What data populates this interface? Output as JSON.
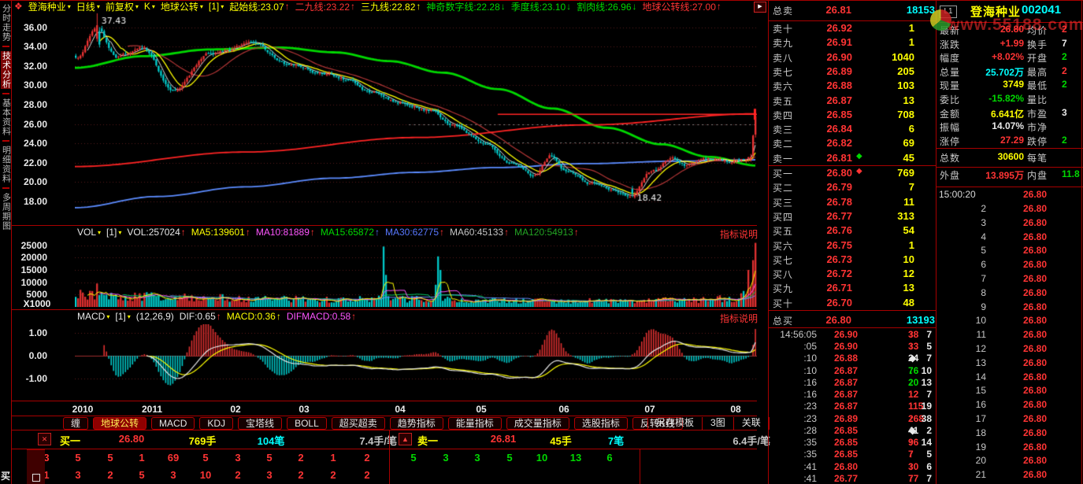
{
  "colors": {
    "up_red": "#ee3434",
    "down_cyan": "#00cdcd",
    "accent_yellow": "#ffff00",
    "accent_cyan": "#00ffff",
    "accent_green": "#00d800",
    "border_red": "#a80000",
    "label_gray": "#c8c8c8"
  },
  "icons": {
    "app": "❖",
    "dropdown": "▾",
    "play": "▶",
    "close": "✕",
    "up": "▲",
    "diamond": "◆",
    "arrow_up": "↑",
    "arrow_down": "↓"
  },
  "sidebar": {
    "items": [
      {
        "label": "分时走势",
        "active": false
      },
      {
        "label": "技术分析",
        "active": true
      },
      {
        "label": "基本资料",
        "active": false
      },
      {
        "label": "明细资料",
        "active": false
      },
      {
        "label": "多周期图",
        "active": false
      }
    ]
  },
  "chart_header": {
    "items": [
      {
        "t": "登海种业",
        "dd": true,
        "c": "yellow"
      },
      {
        "t": "日线",
        "dd": true,
        "c": "yellow"
      },
      {
        "t": "前复权",
        "dd": true,
        "c": "yellow"
      },
      {
        "t": "K",
        "dd": true,
        "c": "yellow"
      },
      {
        "t": "地球公转",
        "dd": true,
        "c": "yellow"
      },
      {
        "t": "[1]",
        "dd": true,
        "c": "yellow"
      },
      {
        "t": "起始线:23.07",
        "a": "↑",
        "c": "yellow",
        "ac": "red"
      },
      {
        "t": "二九线:23.22",
        "a": "↑",
        "c": "red",
        "ac": "red"
      },
      {
        "t": "三九线:22.82",
        "a": "↑",
        "c": "yellow",
        "ac": "yellow"
      },
      {
        "t": "神奇数字线:22.28",
        "a": "↓",
        "c": "green",
        "ac": "green"
      },
      {
        "t": "季度线:23.10",
        "a": "↓",
        "c": "green",
        "ac": "green"
      },
      {
        "t": "割肉线:26.96",
        "a": "↓",
        "c": "green",
        "ac": "green"
      },
      {
        "t": "地球公转线:27.00",
        "a": "↑",
        "c": "red",
        "ac": "red"
      }
    ]
  },
  "main_chart": {
    "y_ticks": [
      "36.00",
      "34.00",
      "32.00",
      "30.00",
      "28.00",
      "26.00",
      "24.00",
      "22.00",
      "20.00",
      "18.00"
    ]
  },
  "volume_pane": {
    "legend_note": "指标说明",
    "unit": "X1000",
    "ticks": [
      "25000",
      "20000",
      "15000",
      "10000",
      "5000"
    ],
    "items": [
      {
        "t": "VOL",
        "dd": true,
        "c": "white"
      },
      {
        "t": "[1]",
        "dd": true,
        "c": "white"
      },
      {
        "t": "VOL:257024",
        "a": "↑",
        "c": "white",
        "ac": "red"
      },
      {
        "t": "MA5:139601",
        "a": "↑",
        "c": "yellow",
        "ac": "red"
      },
      {
        "t": "MA10:81889",
        "a": "↑",
        "c": "magenta",
        "ac": "red"
      },
      {
        "t": "MA15:65872",
        "a": "↑",
        "c": "green",
        "ac": "blue"
      },
      {
        "t": "MA30:62775",
        "a": "↑",
        "c": "blue",
        "ac": "red"
      },
      {
        "t": "MA60:45133",
        "a": "↑",
        "c": "gray",
        "ac": "red"
      },
      {
        "t": "MA120:54913",
        "a": "↑",
        "c": "green2",
        "ac": "red"
      }
    ]
  },
  "macd_pane": {
    "legend_note": "指标说明",
    "ticks": [
      "1.00",
      "0.00",
      "-1.00"
    ],
    "items": [
      {
        "t": "MACD",
        "dd": true,
        "c": "white"
      },
      {
        "t": "[1]",
        "dd": true,
        "c": "white"
      },
      {
        "t": "(12,26,9)",
        "c": "white"
      },
      {
        "t": "DIF:0.65",
        "a": "↑",
        "c": "white",
        "ac": "red"
      },
      {
        "t": "MACD:0.36",
        "a": "↑",
        "c": "yellow",
        "ac": "yellow"
      },
      {
        "t": "DIFMACD:0.58",
        "a": "↑",
        "c": "magenta",
        "ac": "red"
      }
    ]
  },
  "x_axis": [
    "2010",
    "2011",
    "02",
    "03",
    "04",
    "05",
    "06",
    "07",
    "08"
  ],
  "tabs": {
    "left": [
      "缠",
      "地球公转",
      "MACD",
      "KDJ",
      "宝塔线",
      "BOLL",
      "超买超卖",
      "趋势指标",
      "能量指标",
      "成交量指标",
      "选股指标",
      "反转K线"
    ],
    "active_index": 1,
    "right": [
      "另存模板",
      "3图",
      "关联"
    ]
  },
  "bottom": {
    "buy": {
      "label": "买一",
      "price": "26.80",
      "lots": "769手",
      "counts": "104笔",
      "avg": "7.4手/笔"
    },
    "sell": {
      "label": "卖一",
      "price": "26.81",
      "lots": "45手",
      "counts": "7笔",
      "avg": "6.4手/笔"
    },
    "grid": {
      "row1_red": [
        "3",
        "5",
        "5",
        "1",
        "69",
        "5",
        "3",
        "5",
        "2",
        "1",
        "2"
      ],
      "row1_green": [
        "5",
        "3",
        "3",
        "5",
        "10",
        "13",
        "6"
      ],
      "row2_red": [
        "1",
        "3",
        "2",
        "5",
        "3",
        "10",
        "2",
        "3",
        "2",
        "2",
        "2"
      ],
      "row2_green": []
    },
    "corner": "买"
  },
  "right_panel": {
    "watermark": "www.55188.com",
    "total_sell": {
      "label": "总卖",
      "price": "26.81",
      "volume": "18153"
    },
    "total_buy": {
      "label": "总买",
      "price": "26.80",
      "volume": "13193"
    },
    "sell_levels": [
      {
        "label": "卖十",
        "price": "26.92",
        "vol": "1"
      },
      {
        "label": "卖九",
        "price": "26.91",
        "vol": "1"
      },
      {
        "label": "卖八",
        "price": "26.90",
        "vol": "1040"
      },
      {
        "label": "卖七",
        "price": "26.89",
        "vol": "205"
      },
      {
        "label": "卖六",
        "price": "26.88",
        "vol": "103"
      },
      {
        "label": "卖五",
        "price": "26.87",
        "vol": "13"
      },
      {
        "label": "卖四",
        "price": "26.85",
        "vol": "708"
      },
      {
        "label": "卖三",
        "price": "26.84",
        "vol": "6"
      },
      {
        "label": "卖二",
        "price": "26.82",
        "vol": "69"
      },
      {
        "label": "卖一",
        "price": "26.81",
        "vol": "45",
        "diamond": "green"
      }
    ],
    "buy_levels": [
      {
        "label": "买一",
        "price": "26.80",
        "vol": "769",
        "diamond": "red"
      },
      {
        "label": "买二",
        "price": "26.79",
        "vol": "7"
      },
      {
        "label": "买三",
        "price": "26.78",
        "vol": "11"
      },
      {
        "label": "买四",
        "price": "26.77",
        "vol": "313"
      },
      {
        "label": "买五",
        "price": "26.76",
        "vol": "54"
      },
      {
        "label": "买六",
        "price": "26.75",
        "vol": "1"
      },
      {
        "label": "买七",
        "price": "26.73",
        "vol": "10"
      },
      {
        "label": "买八",
        "price": "26.72",
        "vol": "12"
      },
      {
        "label": "买九",
        "price": "26.71",
        "vol": "13"
      },
      {
        "label": "买十",
        "price": "26.70",
        "vol": "48"
      }
    ],
    "ticks": [
      {
        "time": "14:56:05",
        "price": "26.90",
        "vol": "38",
        "dir": "up",
        "n": "7"
      },
      {
        "time": ":05",
        "price": "26.90",
        "vol": "33",
        "dir": "up",
        "n": "5"
      },
      {
        "time": ":10",
        "price": "26.88",
        "vol": "24",
        "dir": "flat",
        "n": "7"
      },
      {
        "time": ":10",
        "price": "26.87",
        "vol": "76",
        "dir": "down",
        "n": "10"
      },
      {
        "time": ":16",
        "price": "26.87",
        "vol": "20",
        "dir": "down",
        "n": "13"
      },
      {
        "time": ":16",
        "price": "26.87",
        "vol": "12",
        "dir": "up",
        "n": "7"
      },
      {
        "time": ":23",
        "price": "26.87",
        "vol": "115",
        "dir": "up",
        "n": "19"
      },
      {
        "time": ":23",
        "price": "26.89",
        "vol": "268",
        "dir": "up",
        "n": "38"
      },
      {
        "time": ":28",
        "price": "26.85",
        "vol": "41",
        "dir": "flat",
        "n": "2"
      },
      {
        "time": ":35",
        "price": "26.85",
        "vol": "96",
        "dir": "up",
        "n": "14"
      },
      {
        "time": ":35",
        "price": "26.85",
        "vol": "7",
        "dir": "up",
        "n": "5"
      },
      {
        "time": ":41",
        "price": "26.80",
        "vol": "30",
        "dir": "up",
        "n": "6"
      },
      {
        "time": ":41",
        "price": "26.77",
        "vol": "77",
        "dir": "up",
        "n": "7"
      }
    ],
    "info": {
      "badge": "L1",
      "name": "登海种业",
      "code": "002041",
      "stats": [
        {
          "l": "最新",
          "lv": "26.80",
          "lc": "red",
          "r": "均价",
          "rv": "2",
          "rc": "red"
        },
        {
          "l": "涨跌",
          "lv": "+1.99",
          "lc": "red",
          "r": "换手",
          "rv": "7",
          "rc": "white"
        },
        {
          "l": "幅度",
          "lv": "+8.02%",
          "lc": "red",
          "r": "开盘",
          "rv": "2",
          "rc": "green"
        },
        {
          "l": "总量",
          "lv": "25.702万",
          "lc": "cyan",
          "r": "最高",
          "rv": "2",
          "rc": "red"
        },
        {
          "l": "现量",
          "lv": "3749",
          "lc": "yellow",
          "r": "最低",
          "rv": "2",
          "rc": "green"
        },
        {
          "l": "委比",
          "lv": "-15.82%",
          "lc": "green",
          "r": "量比",
          "rv": "",
          "rc": "white"
        },
        {
          "l": "金额",
          "lv": "6.641亿",
          "lc": "yellow",
          "r": "市盈",
          "rv": "3",
          "rc": "white"
        },
        {
          "l": "振幅",
          "lv": "14.07%",
          "lc": "white",
          "r": "市净",
          "rv": "",
          "rc": "white"
        },
        {
          "l": "涨停",
          "lv": "27.29",
          "lc": "red",
          "r": "跌停",
          "rv": "2",
          "rc": "green"
        }
      ],
      "totals": [
        {
          "l": "总数",
          "lv": "30600",
          "lc": "yellow",
          "r": "每笔",
          "rv": "",
          "rc": "white"
        },
        {
          "l": "外盘",
          "lv": "13.895万",
          "lc": "red",
          "r": "内盘",
          "rv": "11.8",
          "rc": "green"
        }
      ],
      "auction_first": {
        "time": "15:00:20",
        "price": "26.80"
      },
      "auction_rows": [
        {
          "idx": "2",
          "price": "26.80"
        },
        {
          "idx": "3",
          "price": "26.80"
        },
        {
          "idx": "4",
          "price": "26.80"
        },
        {
          "idx": "5",
          "price": "26.80"
        },
        {
          "idx": "6",
          "price": "26.80"
        },
        {
          "idx": "7",
          "price": "26.80"
        },
        {
          "idx": "8",
          "price": "26.80"
        },
        {
          "idx": "9",
          "price": "26.80"
        },
        {
          "idx": "10",
          "price": "26.80"
        },
        {
          "idx": "11",
          "price": "26.80"
        },
        {
          "idx": "12",
          "price": "26.80"
        },
        {
          "idx": "13",
          "price": "26.80"
        },
        {
          "idx": "14",
          "price": "26.80"
        },
        {
          "idx": "15",
          "price": "26.80"
        },
        {
          "idx": "16",
          "price": "26.80"
        },
        {
          "idx": "17",
          "price": "26.80"
        },
        {
          "idx": "18",
          "price": "26.80"
        },
        {
          "idx": "19",
          "price": "26.80"
        },
        {
          "idx": "20",
          "price": "26.80"
        },
        {
          "idx": "21",
          "price": "26.80"
        }
      ]
    }
  },
  "chart_data": {
    "type": "candlestick",
    "title": "登海种业 002041 日线",
    "x_axis_labels": [
      "2010",
      "2011",
      "02",
      "03",
      "04",
      "05",
      "06",
      "07",
      "08"
    ],
    "price_ticks": [
      36,
      34,
      32,
      30,
      28,
      26,
      24,
      22,
      20,
      18
    ],
    "price_path": [
      [
        0,
        32.8
      ],
      [
        0.03,
        36.0
      ],
      [
        0.06,
        32.8
      ],
      [
        0.1,
        33.8
      ],
      [
        0.145,
        29.5
      ],
      [
        0.2,
        33.2
      ],
      [
        0.25,
        34.3
      ],
      [
        0.32,
        32.0
      ],
      [
        0.36,
        31.2
      ],
      [
        0.4,
        30.5
      ],
      [
        0.44,
        29.3
      ],
      [
        0.48,
        28.4
      ],
      [
        0.52,
        27.6
      ],
      [
        0.555,
        26.3
      ],
      [
        0.6,
        24.3
      ],
      [
        0.645,
        21.8
      ],
      [
        0.675,
        20.6
      ],
      [
        0.7,
        22.6
      ],
      [
        0.72,
        21.0
      ],
      [
        0.76,
        19.8
      ],
      [
        0.815,
        18.6
      ],
      [
        0.85,
        21.3
      ],
      [
        0.875,
        22.6
      ],
      [
        0.9,
        21.8
      ],
      [
        0.93,
        22.3
      ],
      [
        0.96,
        22.0
      ],
      [
        0.985,
        22.4
      ],
      [
        1,
        24.0
      ]
    ],
    "ma_long_green": [
      [
        0,
        31.8
      ],
      [
        0.1,
        33.0
      ],
      [
        0.2,
        33.7
      ],
      [
        0.3,
        33.9
      ],
      [
        0.38,
        33.4
      ],
      [
        0.46,
        32.5
      ],
      [
        0.54,
        31.3
      ],
      [
        0.62,
        29.6
      ],
      [
        0.7,
        27.6
      ],
      [
        0.78,
        25.6
      ],
      [
        0.86,
        23.9
      ],
      [
        0.93,
        22.6
      ],
      [
        1,
        21.7
      ]
    ],
    "ma_blue": [
      [
        0,
        17.35
      ],
      [
        0.12,
        18.5
      ],
      [
        0.25,
        19.5
      ],
      [
        0.38,
        20.4
      ],
      [
        0.5,
        21.0
      ],
      [
        0.62,
        21.5
      ],
      [
        0.75,
        21.9
      ],
      [
        0.88,
        22.15
      ],
      [
        1,
        22.3
      ]
    ],
    "trend_red": [
      [
        0,
        21.6
      ],
      [
        0.25,
        23.1
      ],
      [
        0.5,
        24.6
      ],
      [
        0.75,
        25.9
      ],
      [
        1,
        27.05
      ]
    ],
    "level_line_red": 27.0,
    "dotted_levels": [
      25.95,
      24.1
    ],
    "high_annotation": {
      "x": 0.032,
      "price": 37.43,
      "label": "37.43"
    },
    "low_annotation": {
      "x": 0.815,
      "price": 18.42,
      "label": "18.42"
    },
    "last_candle": {
      "open": 24.9,
      "close": 26.8,
      "high": 27.0,
      "low": 24.6
    },
    "volume_profile": [
      [
        0,
        5200
      ],
      [
        0.1,
        4200
      ],
      [
        0.2,
        3600
      ],
      [
        0.3,
        3200
      ],
      [
        0.4,
        3000
      ],
      [
        0.45,
        3400
      ],
      [
        0.5,
        3200
      ],
      [
        0.6,
        2600
      ],
      [
        0.7,
        2400
      ],
      [
        0.8,
        2600
      ],
      [
        0.9,
        2800
      ],
      [
        0.97,
        3600
      ],
      [
        1,
        6000
      ]
    ],
    "volume_spikes": [
      [
        0.031,
        9500
      ],
      [
        0.452,
        24500
      ],
      [
        0.456,
        13000
      ],
      [
        0.528,
        9000
      ],
      [
        0.532,
        20500
      ],
      [
        0.537,
        15000
      ],
      [
        0.99,
        15000
      ],
      [
        0.9965,
        19000
      ],
      [
        1,
        26000
      ]
    ],
    "volume_ticks": [
      25000,
      20000,
      15000,
      10000,
      5000
    ],
    "macd_ticks": [
      1.0,
      0.0,
      -1.0
    ]
  }
}
